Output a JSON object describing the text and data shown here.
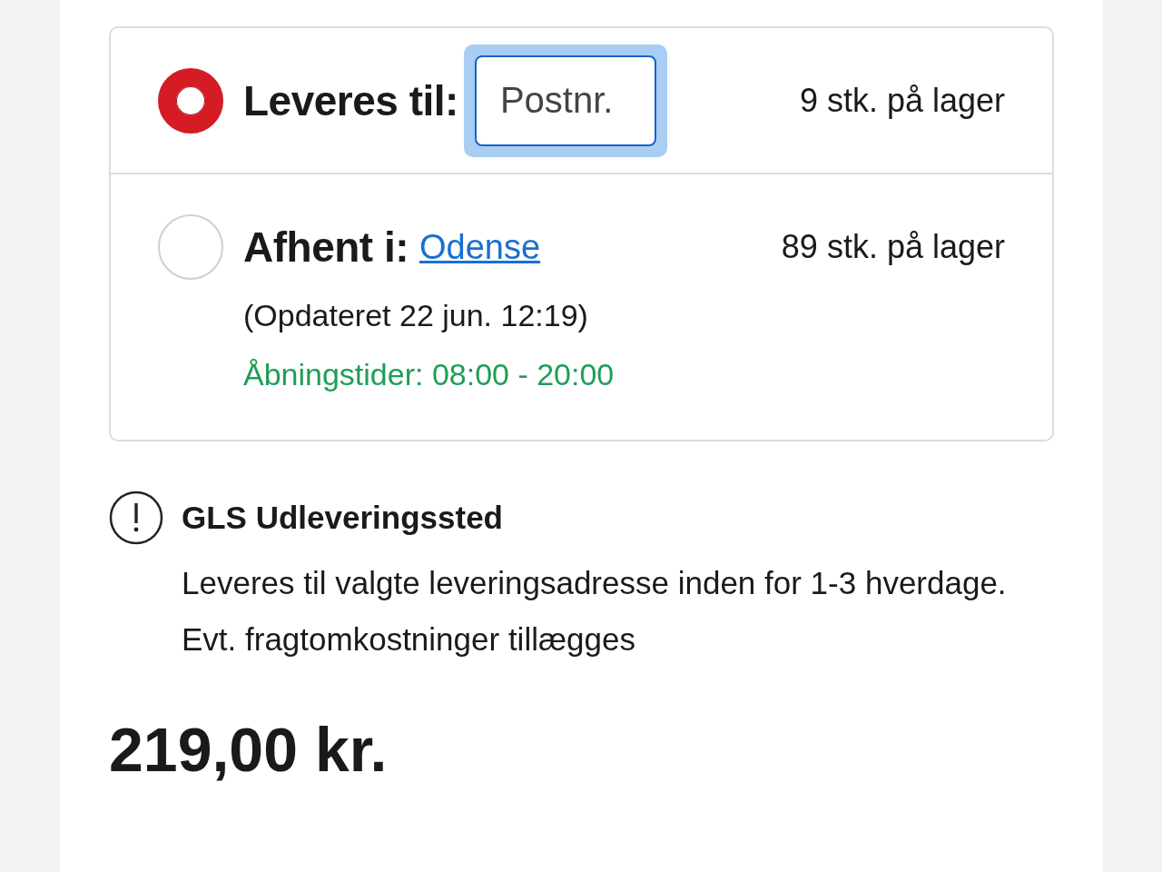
{
  "delivery_options": [
    {
      "kind": "delivery",
      "selected": true,
      "label": "Leveres til:",
      "postcode_field": {
        "placeholder": "Postnr.",
        "focused": true
      },
      "stock": "9 stk. på lager"
    },
    {
      "kind": "pickup",
      "selected": false,
      "label": "Afhent i:",
      "store_link": "Odense",
      "stock": "89 stk. på lager",
      "updated": "(Opdateret 22 jun. 12:19)",
      "opening_hours": "Åbningstider: 08:00 - 20:00"
    }
  ],
  "notice": {
    "title": "GLS Udleveringssted",
    "lines": [
      "Leveres til valgte leveringsadresse inden for 1-3 hverdage.",
      "Evt. fragtomkostninger tillægges"
    ]
  },
  "price": "219,00 kr."
}
